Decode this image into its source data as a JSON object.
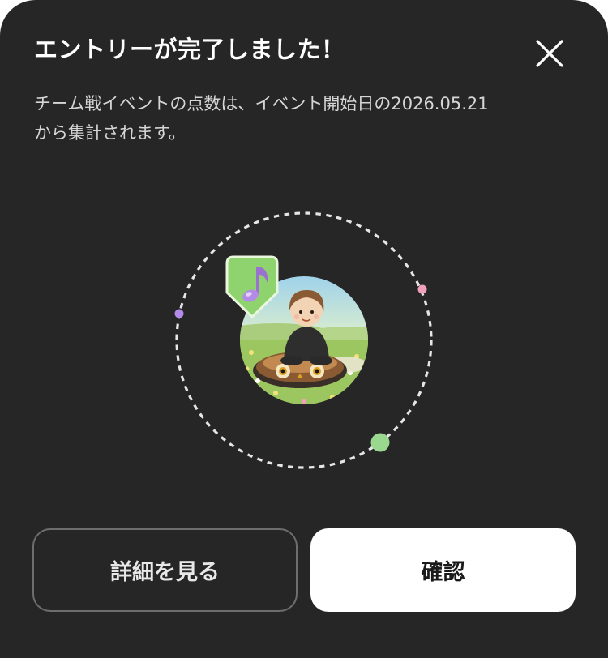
{
  "dialog": {
    "title": "エントリーが完了しました！",
    "description_lines": [
      "チーム戦イベントの点数は、イベント開始日の2026.05.21",
      "から集計されます。"
    ]
  },
  "buttons": {
    "detail_label": "詳細を見る",
    "confirm_label": "確認"
  },
  "icons": {
    "close": "close-icon",
    "badge": "music-note-icon"
  },
  "colors": {
    "background": "#262626",
    "badge_green": "#8fd36e",
    "dot_purple": "#b48ae8",
    "dot_pink": "#f0a0b8",
    "dot_green": "#9ad88f"
  }
}
